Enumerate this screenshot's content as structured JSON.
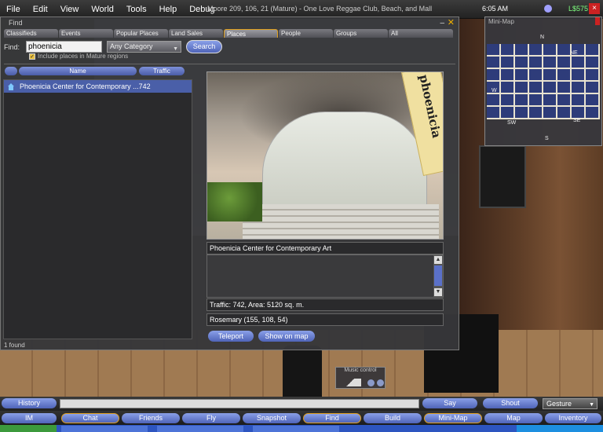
{
  "menubar": {
    "items": [
      "File",
      "Edit",
      "View",
      "World",
      "Tools",
      "Help",
      "Debug"
    ],
    "location": "Moore 209, 106, 21 (Mature) - One Love Reggae Club, Beach, and Mall",
    "clock": "6:05 AM",
    "balance": "L$575"
  },
  "find": {
    "title": "Find",
    "tabs": [
      "Classifieds",
      "Events",
      "Popular Places",
      "Land Sales",
      "Places",
      "People",
      "Groups",
      "All"
    ],
    "active_tab": "Places",
    "find_label": "Find:",
    "query": "phoenicia",
    "category": "Any Category",
    "search_label": "Search",
    "mature_label": "Include places in Mature regions",
    "mature_checked": true,
    "columns": {
      "name": "Name",
      "traffic": "Traffic"
    },
    "results": [
      {
        "label": "Phoenicia Center for Contemporary ...742"
      }
    ],
    "found_count": "1 found",
    "detail": {
      "name": "Phoenicia Center for Contemporary Art",
      "banner_text": "phoenicia",
      "traffic": "Traffic: 742, Area: 5120 sq. m.",
      "location": "Rosemary (155, 108, 54)",
      "teleport_label": "Teleport",
      "show_map_label": "Show on map"
    }
  },
  "minimap": {
    "title": "Mini-Map",
    "compass": {
      "n": "N",
      "ne": "NE",
      "w": "W",
      "sw": "SW",
      "s": "S",
      "se": "SE"
    }
  },
  "music": {
    "label": "Music control"
  },
  "chatbar": {
    "history": "History",
    "say": "Say",
    "shout": "Shout",
    "gesture": "Gesture"
  },
  "toolbar": {
    "buttons": [
      "IM",
      "Chat",
      "Friends",
      "Fly",
      "Snapshot",
      "Find",
      "Build",
      "Mini-Map",
      "Map",
      "Inventory"
    ]
  },
  "colors": {
    "accent_blue": "#4f64b8",
    "highlight_orange": "#e0a020",
    "balance_green": "#7fff7f"
  }
}
